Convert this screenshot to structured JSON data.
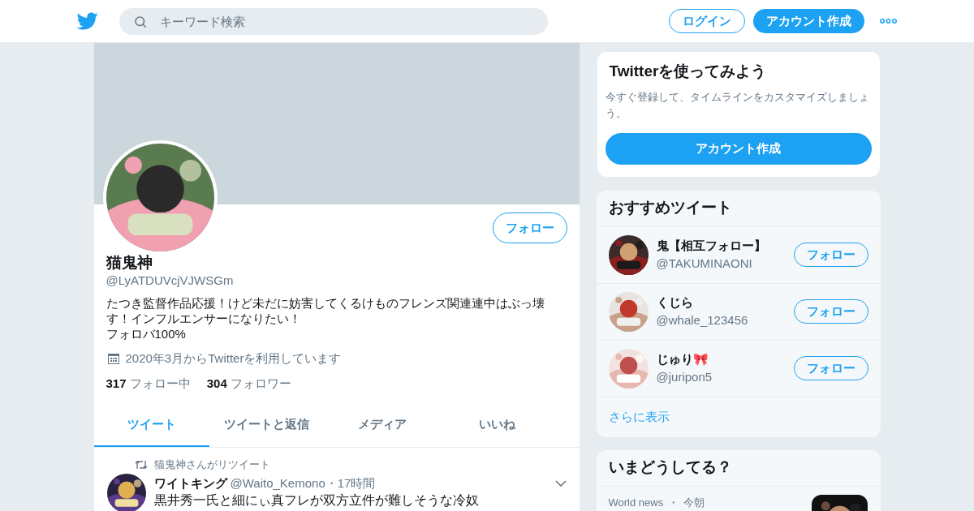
{
  "header": {
    "search": {
      "placeholder": "キーワード検索"
    },
    "login_button": "ログイン",
    "signup_button": "アカウント作成"
  },
  "profile": {
    "name": "猫鬼神",
    "handle": "@LyATDUVcjVJWSGm",
    "follow_button": "フォロー",
    "bio": [
      "たつき監督作品応援！けど未だに妨害してくるけものフレンズ関連連中はぶっ壊す！インフルエンサーになりたい！",
      "フォロバ100%"
    ],
    "joined": "2020年3月からTwitterを利用しています",
    "stats": [
      {
        "count": "317",
        "label": "フォロー中"
      },
      {
        "count": "304",
        "label": "フォロワー"
      }
    ]
  },
  "tabs": [
    {
      "label": "ツイート",
      "selected": true
    },
    {
      "label": "ツイートと返信",
      "selected": false
    },
    {
      "label": "メディア",
      "selected": false
    },
    {
      "label": "いいね",
      "selected": false
    }
  ],
  "tweet": {
    "retweeted_by": "猫鬼神さんがリツイート",
    "name": "ワイトキング",
    "handle": "@Waito_Kemono",
    "time": "・17時間",
    "text": "黒井秀一氏と細にぃ真フレが双方立件が難しそうな冷奴"
  },
  "signup_card": {
    "title": "Twitterを使ってみよう",
    "text": "今すぐ登録して、タイムラインをカスタマイズしましょう。",
    "button": "アカウント作成"
  },
  "suggestions": {
    "title": "おすすめツイート",
    "users": [
      {
        "name": "鬼【相互フォロー】",
        "handle": "@TAKUMINAONI",
        "button": "フォロー"
      },
      {
        "name": "くじら",
        "handle": "@whale_123456",
        "button": "フォロー"
      },
      {
        "name": "じゅり🎀",
        "handle": "@juripon5",
        "button": "フォロー"
      }
    ],
    "more_link": "さらに表示"
  },
  "trends": {
    "title": "いまどうしてる？",
    "items": [
      {
        "source": "World news",
        "separator": "・",
        "time": "今朝"
      }
    ]
  }
}
